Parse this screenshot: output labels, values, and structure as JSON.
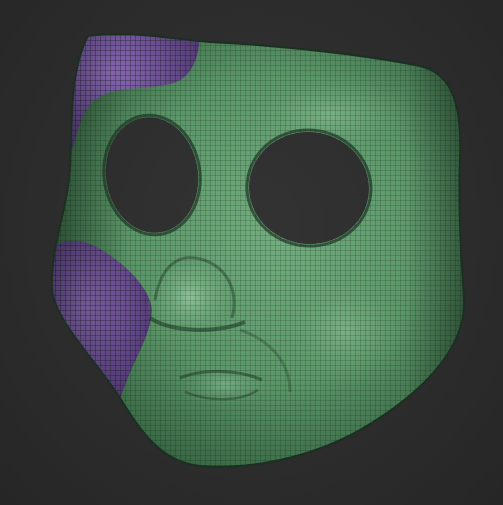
{
  "viewport": {
    "background": "#2d2d2d",
    "model": {
      "object": "mask-icon",
      "wireframe": true,
      "polygroups": [
        {
          "color": "#5f9a6c"
        },
        {
          "color": "#7a5aa3"
        }
      ]
    }
  }
}
